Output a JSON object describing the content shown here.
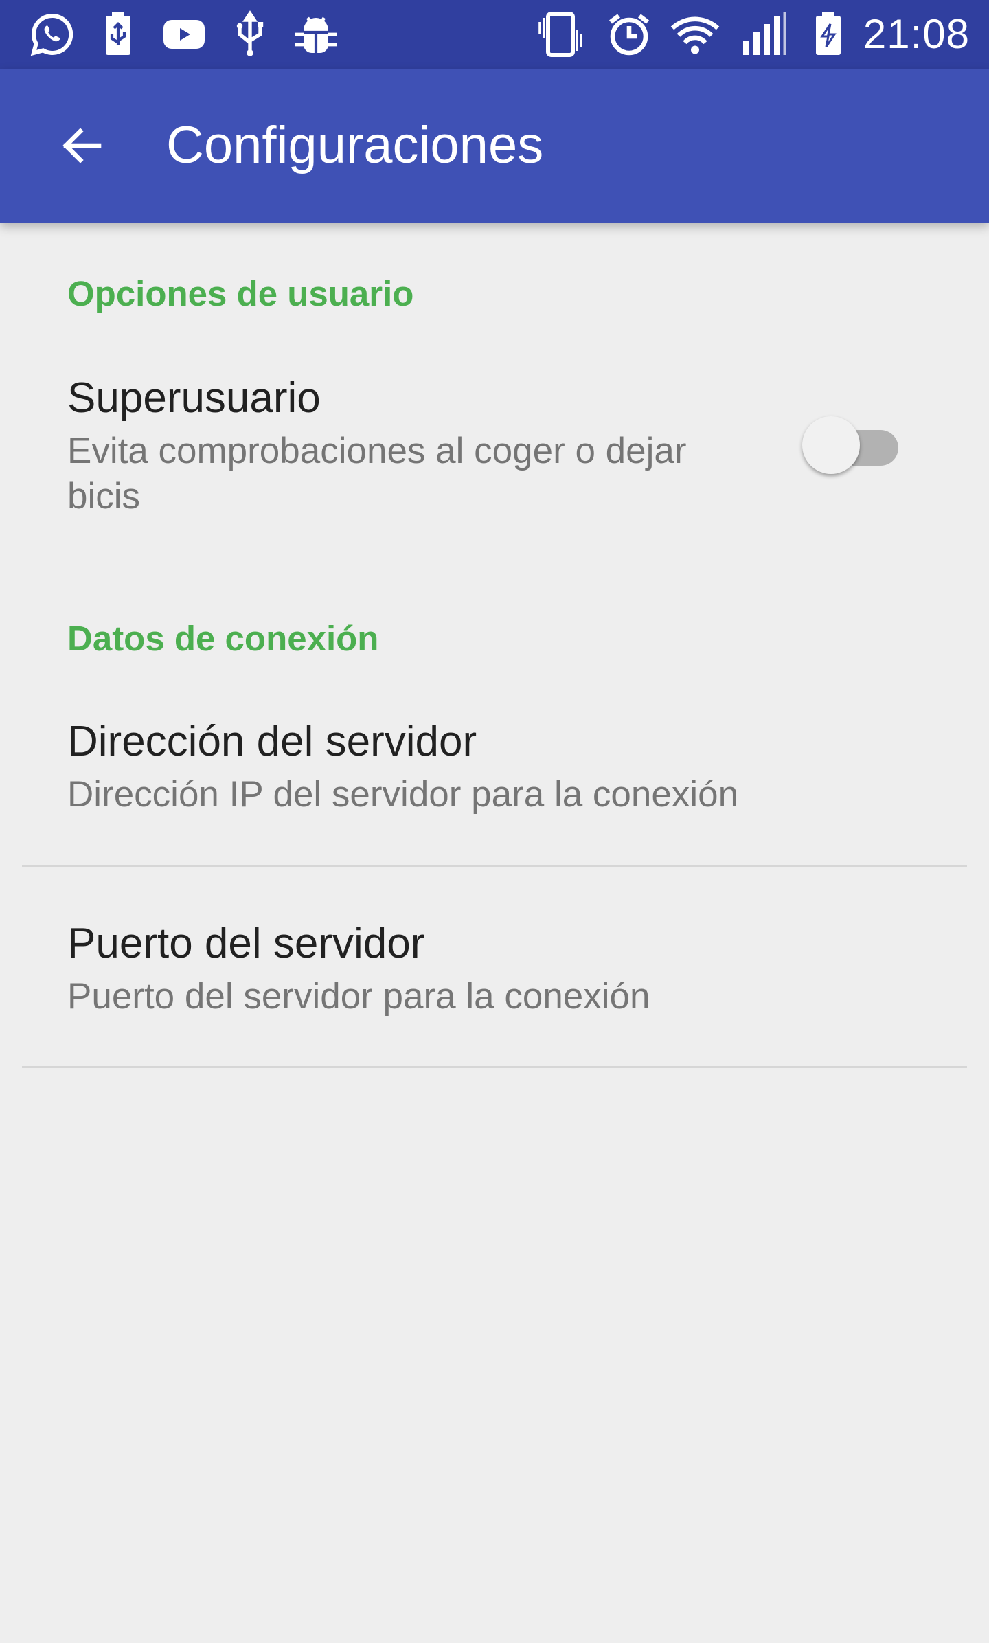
{
  "status_bar": {
    "time": "21:08",
    "left_icons": [
      "whatsapp-icon",
      "usb-storage-icon",
      "youtube-icon",
      "usb-icon",
      "android-debug-icon"
    ],
    "right_icons": [
      "vibrate-icon",
      "alarm-icon",
      "wifi-icon",
      "signal-icon",
      "battery-charging-icon"
    ]
  },
  "toolbar": {
    "title": "Configuraciones",
    "back_icon": "arrow-back-icon"
  },
  "sections": {
    "user_options": {
      "header": "Opciones de usuario",
      "superuser": {
        "title": "Superusuario",
        "summary": "Evita comprobaciones al coger o dejar bicis",
        "enabled": false
      }
    },
    "connection": {
      "header": "Datos de conexión",
      "server_address": {
        "title": "Dirección del servidor",
        "summary": "Dirección IP del servidor para la conexión"
      },
      "server_port": {
        "title": "Puerto del servidor",
        "summary": "Puerto del servidor para la conexión"
      }
    }
  },
  "colors": {
    "status_bar": "#303f9f",
    "toolbar": "#3f51b5",
    "category": "#4caf50",
    "background": "#eeeeee"
  }
}
